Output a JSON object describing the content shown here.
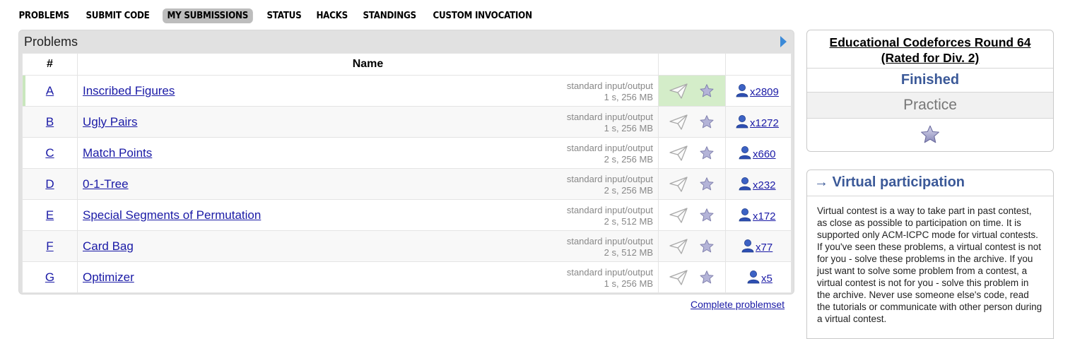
{
  "menu": {
    "items": [
      {
        "label": "PROBLEMS",
        "active": false
      },
      {
        "label": "SUBMIT CODE",
        "active": false
      },
      {
        "label": "MY SUBMISSIONS",
        "active": true
      },
      {
        "label": "STATUS",
        "active": false
      },
      {
        "label": "HACKS",
        "active": false
      },
      {
        "label": "STANDINGS",
        "active": false
      },
      {
        "label": "CUSTOM INVOCATION",
        "active": false
      }
    ]
  },
  "problems_panel": {
    "title": "Problems",
    "headers": {
      "index": "#",
      "name": "Name"
    },
    "rows": [
      {
        "index": "A",
        "name": "Inscribed Figures",
        "io": "standard input/output",
        "limits": "1 s, 256 MB",
        "solvers": "x2809",
        "solved": true
      },
      {
        "index": "B",
        "name": "Ugly Pairs",
        "io": "standard input/output",
        "limits": "1 s, 256 MB",
        "solvers": "x1272",
        "solved": false
      },
      {
        "index": "C",
        "name": "Match Points",
        "io": "standard input/output",
        "limits": "2 s, 256 MB",
        "solvers": "x660",
        "solved": false
      },
      {
        "index": "D",
        "name": "0-1-Tree",
        "io": "standard input/output",
        "limits": "2 s, 256 MB",
        "solvers": "x232",
        "solved": false
      },
      {
        "index": "E",
        "name": "Special Segments of Permutation",
        "io": "standard input/output",
        "limits": "2 s, 512 MB",
        "solvers": "x172",
        "solved": false
      },
      {
        "index": "F",
        "name": "Card Bag",
        "io": "standard input/output",
        "limits": "2 s, 512 MB",
        "solvers": "x77",
        "solved": false
      },
      {
        "index": "G",
        "name": "Optimizer",
        "io": "standard input/output",
        "limits": "1 s, 256 MB",
        "solvers": "x5",
        "solved": false
      }
    ],
    "complete_link": "Complete problemset"
  },
  "contest_box": {
    "title_line1": "Educational Codeforces Round 64",
    "title_line2": "(Rated for Div. 2)",
    "phase": "Finished",
    "mode": "Practice"
  },
  "virtual_participation": {
    "heading": "→ Virtual participation",
    "text": "Virtual contest is a way to take part in past contest, as close as possible to participation on time. It is supported only ACM-ICPC mode for virtual contests. If you've seen these problems, a virtual contest is not for you - solve these problems in the archive. If you just want to solve some problem from a contest, a virtual contest is not for you - solve this problem in the archive. Never use someone else's code, read the tutorials or communicate with other person during a virtual contest."
  },
  "colors": {
    "accent_blue": "#3b5998",
    "link": "#1a1aa6",
    "solved_green": "#d4edc9",
    "active_tab": "#bdbdbd"
  },
  "icons": {
    "submit": "paper-plane-icon",
    "favorite": "star-icon",
    "solvers": "user-icon",
    "collapse": "triangle-right-icon"
  }
}
